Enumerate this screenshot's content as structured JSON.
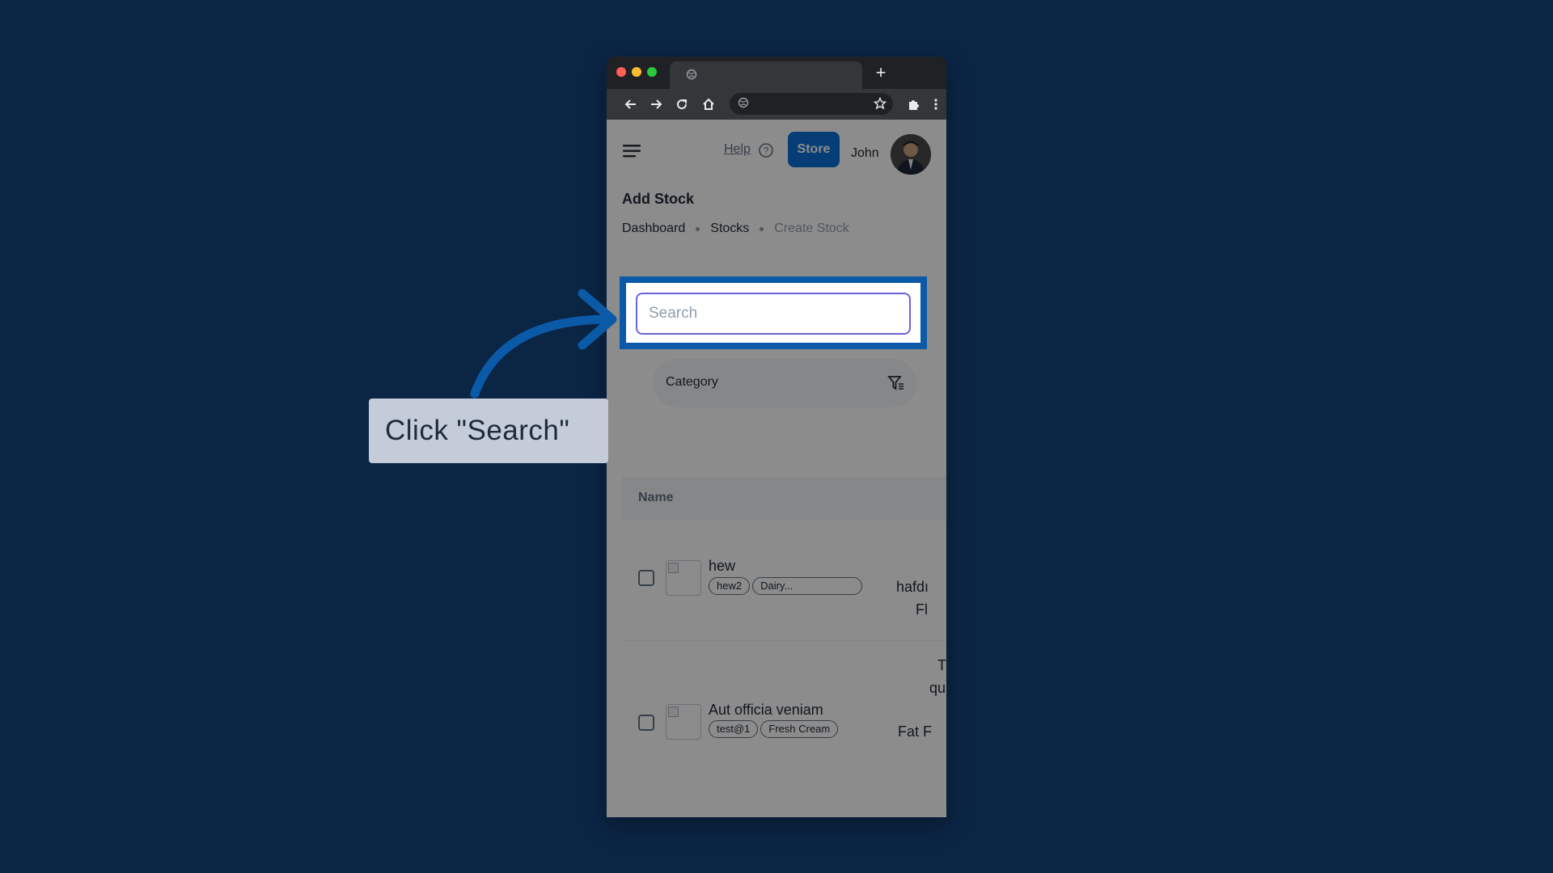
{
  "header": {
    "help_label": "Help",
    "store_label": "Store",
    "user_name": "John"
  },
  "page": {
    "title": "Add Stock",
    "breadcrumb": [
      "Dashboard",
      "Stocks",
      "Create Stock"
    ]
  },
  "search": {
    "placeholder": "Search",
    "value": ""
  },
  "filters": {
    "category_label": "Category"
  },
  "table": {
    "columns": [
      "Name"
    ],
    "rows": [
      {
        "name": "hew",
        "tags": [
          "hew2",
          "Dairy..."
        ],
        "side_text": [
          "hafdı",
          "Fl"
        ]
      },
      {
        "name": "Aut officia veniam",
        "tags": [
          "test@1",
          "Fresh Cream"
        ],
        "side_text": [
          "T",
          "qu",
          "Fat F"
        ]
      }
    ]
  },
  "callout": {
    "text": "Click \"Search\""
  },
  "colors": {
    "background": "#0b2545",
    "highlight": "#0a5aa8",
    "store_button": "#0e6fd8",
    "focus_border": "#6b63d9"
  },
  "icons": [
    "menu-icon",
    "help-icon",
    "filter-icon",
    "globe-icon",
    "back-icon",
    "forward-icon",
    "reload-icon",
    "home-icon",
    "star-icon",
    "extensions-icon",
    "more-icon",
    "arrow-icon"
  ]
}
